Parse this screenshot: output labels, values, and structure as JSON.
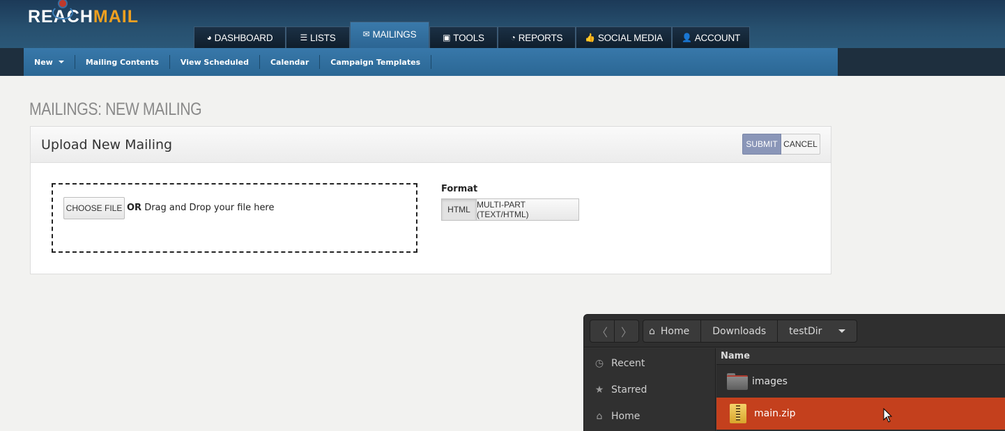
{
  "brand": {
    "part1": "REACH",
    "part2": "MAIL"
  },
  "main_nav": {
    "tabs": [
      {
        "label": "DASHBOARD",
        "icon": "dashboard-icon"
      },
      {
        "label": "LISTS",
        "icon": "list-icon"
      },
      {
        "label": "MAILINGS",
        "icon": "envelope-icon",
        "active": true
      },
      {
        "label": "TOOLS",
        "icon": "toolbox-icon"
      },
      {
        "label": "REPORTS",
        "icon": "pie-chart-icon"
      },
      {
        "label": "SOCIAL MEDIA",
        "icon": "thumbs-up-icon"
      },
      {
        "label": "ACCOUNT",
        "icon": "user-icon"
      }
    ]
  },
  "sub_nav": {
    "items": [
      "New",
      "Mailing Contents",
      "View Scheduled",
      "Calendar",
      "Campaign Templates"
    ]
  },
  "page": {
    "title": "MAILINGS: NEW MAILING",
    "panel_title": "Upload New Mailing",
    "submit_label": "SUBMIT",
    "cancel_label": "CANCEL",
    "choose_file_label": "CHOOSE FILE",
    "drop_or": "OR",
    "drop_text": "Drag and Drop your file here",
    "format_label": "Format",
    "format_options": [
      "HTML",
      "MULTI-PART (TEXT/HTML)"
    ],
    "format_selected": "HTML"
  },
  "file_chooser": {
    "breadcrumbs": [
      "Home",
      "Downloads",
      "testDir"
    ],
    "sidebar": [
      {
        "label": "Recent",
        "icon": "clock-icon"
      },
      {
        "label": "Starred",
        "icon": "star-icon"
      },
      {
        "label": "Home",
        "icon": "home-icon"
      }
    ],
    "column_header": "Name",
    "files": [
      {
        "name": "images",
        "type": "folder",
        "selected": false
      },
      {
        "name": "main.zip",
        "type": "zip",
        "selected": true
      }
    ]
  },
  "colors": {
    "header_bg": "#27506f",
    "subnav_bg": "#2f6c99",
    "accent_orange": "#f0a020",
    "submit_bg": "#8a96b8",
    "selection": "#c4401d"
  }
}
